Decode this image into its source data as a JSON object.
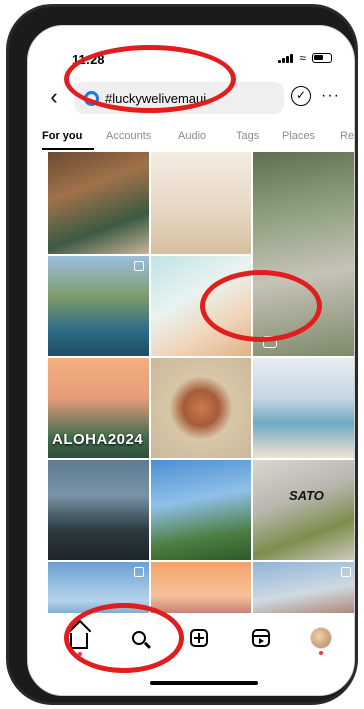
{
  "status_bar": {
    "time": "11:28"
  },
  "search": {
    "query": "#luckywelivemaui"
  },
  "tabs": [
    {
      "label": "For you",
      "active": true
    },
    {
      "label": "Accounts",
      "active": false
    },
    {
      "label": "Audio",
      "active": false
    },
    {
      "label": "Tags",
      "active": false
    },
    {
      "label": "Places",
      "active": false
    },
    {
      "label": "Re",
      "active": false
    }
  ],
  "grid": {
    "overlay_texts": {
      "aloha": "ALOHA2024",
      "sato": "SATO"
    }
  },
  "icons": {
    "back": "back-chevron-icon",
    "search_ring": "hashtag-ring-icon",
    "follow": "check-circle-icon",
    "more": "more-dots-icon",
    "home": "home-icon",
    "search": "search-icon",
    "create": "create-plus-icon",
    "reels": "reels-icon",
    "profile": "profile-avatar-icon"
  },
  "colors": {
    "annotation": "#e11d1d",
    "accent": "#1877f2",
    "notification_dot": "#ff2d55"
  }
}
